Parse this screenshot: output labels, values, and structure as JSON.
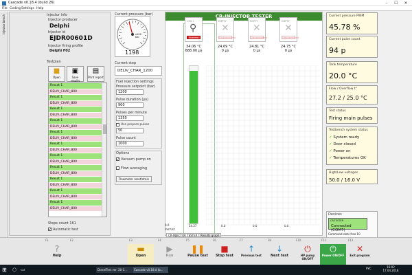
{
  "window": {
    "title": "Cascade v0.18.4 (build 26)"
  },
  "menu": [
    "File",
    "Coding",
    "Settings",
    "Help"
  ],
  "vtab": "Injector bench",
  "injector": {
    "info_label": "Injector info",
    "producer_label": "Injector producer",
    "producer": "Delphi",
    "id_label": "Injector id",
    "id": "EJDR00601D",
    "profile_label": "Injector firing profile",
    "profile": "Delphi F02"
  },
  "testplan": {
    "label": "Testplan",
    "buttons": [
      "Open",
      "Save results",
      "Print report"
    ],
    "rows": [
      {
        "t": "r",
        "v": "Result 1"
      },
      {
        "t": "d",
        "v": "DELIV_CHAR_800"
      },
      {
        "t": "r",
        "v": "Result 1"
      },
      {
        "t": "d",
        "v": "DELIV_CHAR_800"
      },
      {
        "t": "r",
        "v": "Result 1"
      },
      {
        "t": "d",
        "v": "DELIV_CHAR_800"
      },
      {
        "t": "r",
        "v": "Result 1"
      },
      {
        "t": "d",
        "v": "DELIV_CHAR_800"
      },
      {
        "t": "r",
        "v": "Result 1"
      },
      {
        "t": "d",
        "v": "DELIV_CHAR_800"
      },
      {
        "t": "r",
        "v": "Result 1"
      },
      {
        "t": "d",
        "v": "DELIV_CHAR_800"
      },
      {
        "t": "r",
        "v": "Result 1"
      },
      {
        "t": "d",
        "v": "DELIV_CHAR_800"
      },
      {
        "t": "r",
        "v": "Result 1"
      },
      {
        "t": "d",
        "v": "DELIV_CHAR_800"
      },
      {
        "t": "r",
        "v": "Result 1"
      },
      {
        "t": "d",
        "v": "DELIV_CHAR_800"
      },
      {
        "t": "r",
        "v": "Result 1"
      },
      {
        "t": "d",
        "v": "DELIV_CHAR_800"
      },
      {
        "t": "r",
        "v": "Result 1"
      },
      {
        "t": "d",
        "v": "DELIV_CHAR_800"
      }
    ],
    "steps_count": "Steps count 161",
    "auto_test": "Automatic test"
  },
  "pressure": {
    "label": "Current pressure (bar)",
    "value": "1198",
    "unit": "x100\nbar",
    "ticks": [
      "0",
      "2",
      "4",
      "6",
      "8",
      "10",
      "12",
      "14",
      "16",
      "18",
      "20"
    ]
  },
  "step": {
    "label": "Current step",
    "value": "DELIV_CHAR_1200"
  },
  "settings": {
    "label": "Fuel injection settings",
    "pressure_label": "Pressure setpoint (bar)",
    "pressure": "1200",
    "pulse_label": "Pulse duration (µs)",
    "pulse": "900",
    "ppm_label": "Pulses per minute",
    "ppm": "1350",
    "use_prepare": "Use prepare pulses",
    "prepare": "50",
    "count_label": "Pulse count",
    "count": "1000"
  },
  "options": {
    "label": "Options",
    "vacuum": "Vacuum pump on",
    "flow": "Flow averaging",
    "reset": "Flowmeter reset/drain"
  },
  "tester": {
    "title": "CR-INJECTOR TESTER",
    "tab1": "CR-INJECTOR TESTER",
    "tab2": "Results graph",
    "injectors": [
      {
        "num": "CHN 1",
        "state": "Enabled",
        "temp": "34.06 °C",
        "pulse": "688.00 µs"
      },
      {
        "num": "EMPTY",
        "state": "Disconnected",
        "temp": "24.69 °C",
        "pulse": "0 µs"
      },
      {
        "num": "EMPTY",
        "state": "Disconnected",
        "temp": "24.81 °C",
        "pulse": "0 µs"
      },
      {
        "num": "EMPTY",
        "state": "Disconnected",
        "temp": "24.75 °C",
        "pulse": "0 µs"
      }
    ],
    "y0": "0.0",
    "yunit": "mm³/st",
    "barlabel": "54.27",
    "b2": "0.0",
    "b3": "0.0",
    "b4": "0.0",
    "fill": 0.97
  },
  "right": {
    "pwm_label": "Current pressure PWM",
    "pwm": "45.78 %",
    "pulse_label": "Current pulse count",
    "pulse": "94 p",
    "tank_label": "Tank temperature",
    "tank": "20.0 °C",
    "flow_label": "Flow / Overflow t°",
    "flow": "27.2 / 25.0 °C",
    "status_label": "Test status",
    "status": "Firing main pulses",
    "sys_label": "Testbench system status",
    "sys": [
      "System ready",
      "Door closed",
      "Power on",
      "Temperatures OK"
    ],
    "volt_label": "High/Low voltages",
    "volt": "50.0 / 16.0 V",
    "dev_label": "Devices",
    "dev_name": "CR-TESTER",
    "dev": "Connected (COM7)",
    "slots": "Command slots free 10"
  },
  "fkeys": [
    {
      "n": "F1",
      "g": "?",
      "l": "Help",
      "c": "#888"
    },
    {
      "n": "F2",
      "g": "",
      "l": "",
      "c": "#888"
    },
    {
      "n": "F3",
      "g": "▬",
      "l": "Open",
      "c": "#c80"
    },
    {
      "n": "F4",
      "g": "▶",
      "l": "Run",
      "c": "#999"
    },
    {
      "n": "F5",
      "g": "❚❚",
      "l": "Pause test",
      "c": "#e80"
    },
    {
      "n": "F6",
      "g": "■",
      "l": "Stop test",
      "c": "#c22"
    },
    {
      "n": "F7",
      "g": "↑",
      "l": "Previous test",
      "c": "#28c"
    },
    {
      "n": "F8",
      "g": "↓",
      "l": "Next test",
      "c": "#28c"
    },
    {
      "n": "F10",
      "g": "⏻",
      "l": "HP pump ON/OFF",
      "c": "#c22"
    },
    {
      "n": "F11",
      "g": "⏻",
      "l": "Power ON/OFF",
      "c": "#fff"
    },
    {
      "n": "F12",
      "g": "✕",
      "l": "Exit program",
      "c": "#c22"
    }
  ],
  "taskbar": {
    "items": [
      "DieselTest ver. 20-1...",
      "Cascade v0.18.4 (b..."
    ],
    "lang": "РУС",
    "time": "16:02",
    "date": "17.04.2018"
  }
}
